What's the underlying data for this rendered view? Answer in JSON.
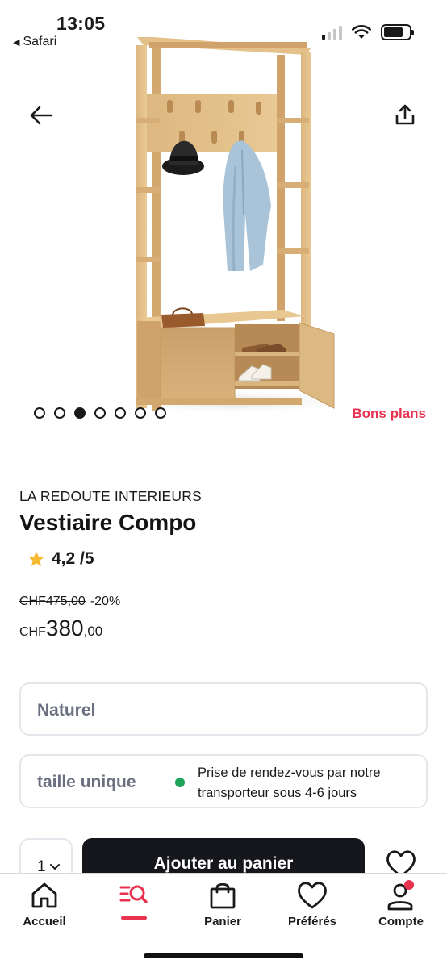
{
  "status_bar": {
    "time": "13:05",
    "back_app": "Safari"
  },
  "hero": {
    "image_description_icon": "coat-rack-bench-image",
    "carousel_total": 7,
    "carousel_active_index": 2,
    "promo_label": "Bons plans"
  },
  "product": {
    "brand": "LA REDOUTE INTERIEURS",
    "title": "Vestiaire Compo",
    "rating": "4,2 /5",
    "old_price": "CHF475,00",
    "discount": "-20%",
    "price_currency": "CHF",
    "price_integer": "380",
    "price_decimal": ",00"
  },
  "options": {
    "color": "Naturel",
    "size": "taille unique",
    "delivery": "Prise de rendez-vous par notre transporteur sous 4-6 jours"
  },
  "cart": {
    "quantity": "1",
    "add_label": "Ajouter au panier"
  },
  "tabbar": {
    "items": [
      {
        "label": "Accueil",
        "icon": "home-icon"
      },
      {
        "label": "",
        "icon": "menu-search-icon"
      },
      {
        "label": "Panier",
        "icon": "shopping-bag-icon"
      },
      {
        "label": "Préférés",
        "icon": "heart-icon"
      },
      {
        "label": "Compte",
        "icon": "user-icon"
      }
    ]
  },
  "colors": {
    "accent": "#e8324f",
    "button": "#15171c",
    "available": "#1fa55b",
    "star": "#f5b82e"
  }
}
